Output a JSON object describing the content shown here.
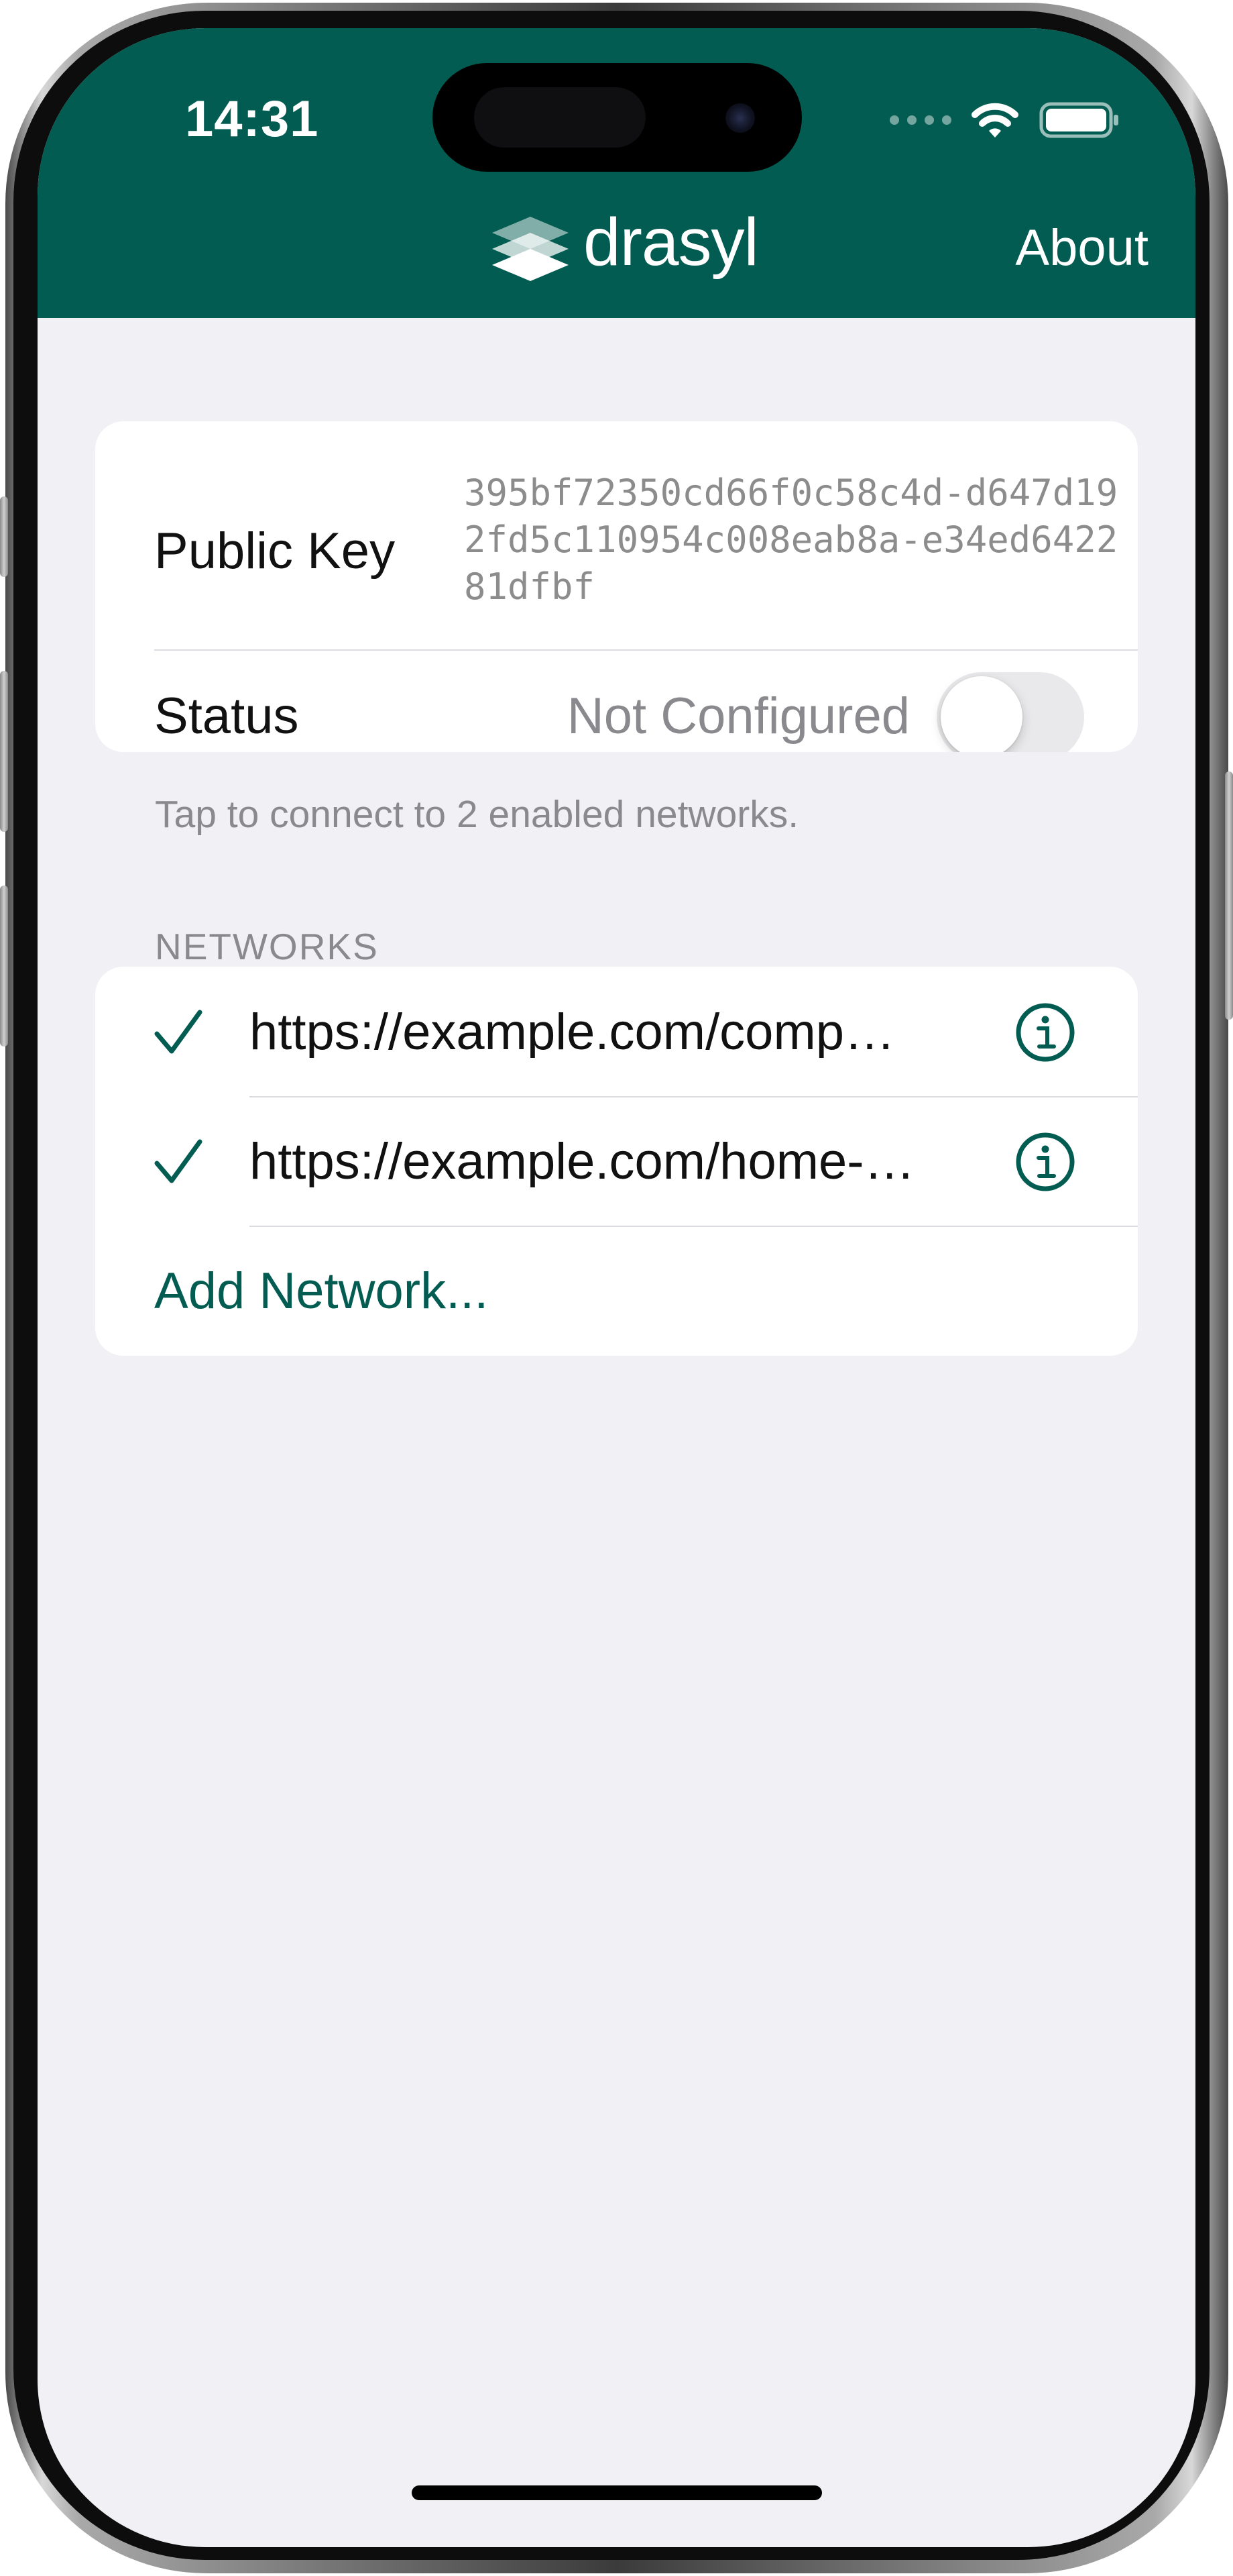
{
  "status_bar": {
    "time": "14:31"
  },
  "header": {
    "logo_text": "drasyl",
    "about_label": "About",
    "color": "#035c51"
  },
  "info": {
    "public_key_label": "Public Key",
    "public_key_value": "395bf72350cd66f0c58c4d-d647d192fd5c110954c008eab8a-e34ed642281dfbf",
    "status_label": "Status",
    "status_value": "Not Configured",
    "toggle_on": false,
    "footnote": "Tap to connect to 2 enabled networks."
  },
  "networks": {
    "section_title": "NETWORKS",
    "items": [
      {
        "url": "https://example.com/compa…",
        "enabled": true,
        "check_icon": "checkmark-icon",
        "info_icon": "info-circle-icon"
      },
      {
        "url": "https://example.com/home-…",
        "enabled": true,
        "check_icon": "checkmark-icon",
        "info_icon": "info-circle-icon"
      }
    ],
    "add_label": "Add Network..."
  },
  "colors": {
    "accent": "#035c51",
    "background": "#f1f1f5",
    "secondary_text": "#8a8a8e"
  }
}
